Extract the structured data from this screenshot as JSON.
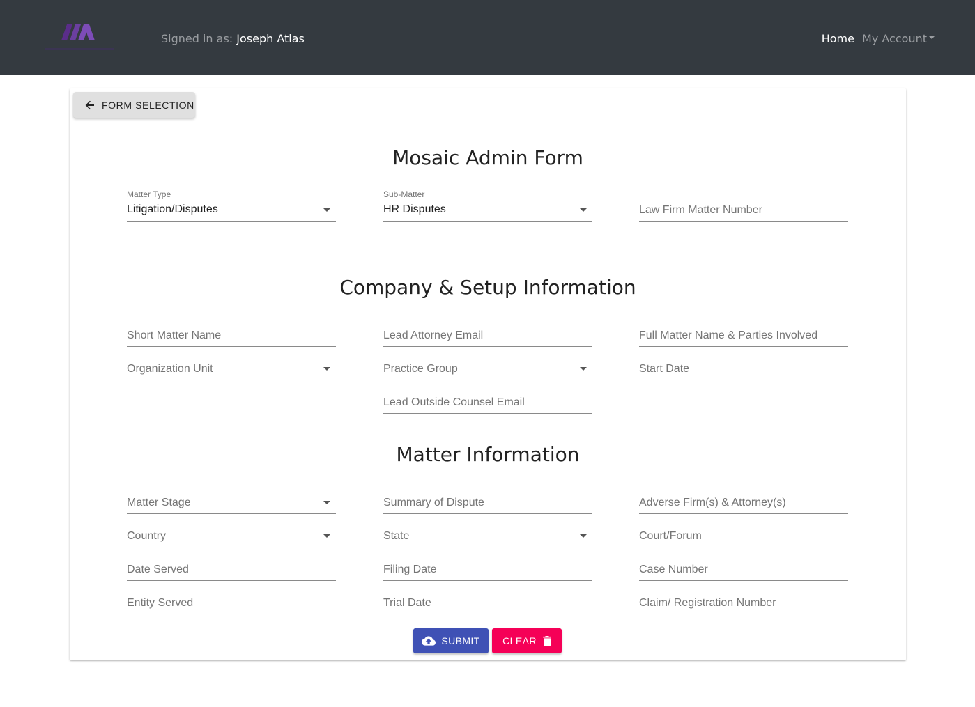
{
  "header": {
    "signed_in_prefix": "Signed in as: ",
    "user_name": "Joseph Atlas",
    "home_label": "Home",
    "account_label": "My Account",
    "brand_color": "#6b3fa0"
  },
  "back_button": {
    "label": "FORM SELECTION"
  },
  "titles": {
    "form": "Mosaic Admin Form",
    "company": "Company & Setup Information",
    "matter": "Matter Information"
  },
  "top_fields": {
    "matter_type_label": "Matter Type",
    "matter_type_value": "Litigation/Disputes",
    "sub_matter_label": "Sub-Matter",
    "sub_matter_value": "HR Disputes",
    "law_firm_matter_number": "Law Firm Matter Number"
  },
  "company_fields": {
    "short_matter_name": "Short Matter Name",
    "lead_attorney_email": "Lead Attorney Email",
    "full_matter_name": "Full Matter Name & Parties Involved",
    "organization_unit": "Organization Unit",
    "practice_group": "Practice Group",
    "start_date": "Start Date",
    "lead_outside_counsel_email": "Lead Outside Counsel Email"
  },
  "matter_fields": {
    "matter_stage": "Matter Stage",
    "summary_of_dispute": "Summary of Dispute",
    "adverse_firms": "Adverse Firm(s) & Attorney(s)",
    "country": "Country",
    "state": "State",
    "court_forum": "Court/Forum",
    "date_served": "Date Served",
    "filing_date": "Filing Date",
    "case_number": "Case Number",
    "entity_served": "Entity Served",
    "trial_date": "Trial Date",
    "claim_registration_number": "Claim/ Registration Number"
  },
  "actions": {
    "submit_label": "SUBMIT",
    "clear_label": "CLEAR",
    "submit_color": "#3f51b5",
    "clear_color": "#f50057"
  }
}
